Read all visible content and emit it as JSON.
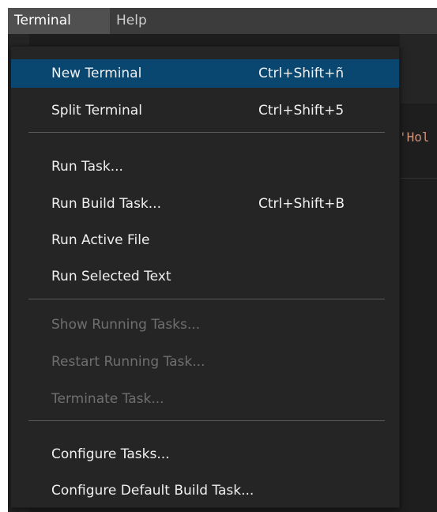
{
  "menubar": {
    "items": [
      {
        "label": "Terminal",
        "active": true
      },
      {
        "label": "Help",
        "active": false
      }
    ]
  },
  "editor": {
    "code_fragment": "'Hol"
  },
  "terminal_menu": {
    "items": [
      {
        "label": "New Terminal",
        "shortcut": "Ctrl+Shift+ñ",
        "state": "selected"
      },
      {
        "label": "Split Terminal",
        "shortcut": "Ctrl+Shift+5",
        "state": "enabled"
      },
      {
        "label": "Run Task...",
        "shortcut": "",
        "state": "enabled"
      },
      {
        "label": "Run Build Task...",
        "shortcut": "Ctrl+Shift+B",
        "state": "enabled"
      },
      {
        "label": "Run Active File",
        "shortcut": "",
        "state": "enabled"
      },
      {
        "label": "Run Selected Text",
        "shortcut": "",
        "state": "enabled"
      },
      {
        "label": "Show Running Tasks...",
        "shortcut": "",
        "state": "disabled"
      },
      {
        "label": "Restart Running Task...",
        "shortcut": "",
        "state": "disabled"
      },
      {
        "label": "Terminate Task...",
        "shortcut": "",
        "state": "disabled"
      },
      {
        "label": "Configure Tasks...",
        "shortcut": "",
        "state": "enabled"
      },
      {
        "label": "Configure Default Build Task...",
        "shortcut": "",
        "state": "enabled"
      }
    ]
  },
  "colors": {
    "menubar_bg": "#3c3c3c",
    "menu_bg": "#252526",
    "selected_bg": "#094771",
    "text": "#f0f0f0",
    "disabled_text": "#6f6f6f",
    "string_color": "#ce9178"
  }
}
